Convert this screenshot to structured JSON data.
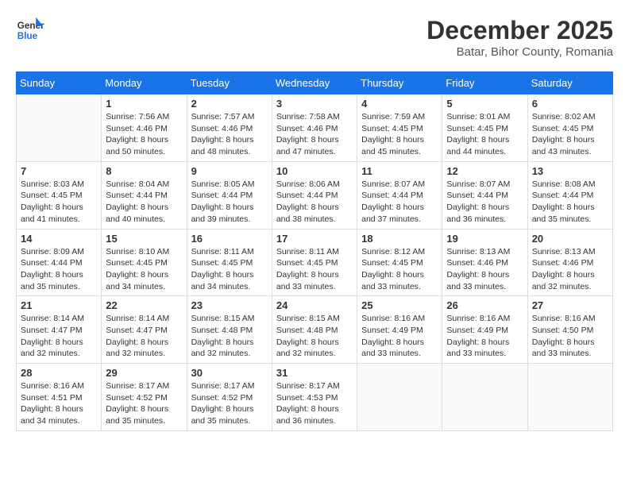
{
  "header": {
    "logo_general": "General",
    "logo_blue": "Blue",
    "month_title": "December 2025",
    "subtitle": "Batar, Bihor County, Romania"
  },
  "calendar": {
    "days_of_week": [
      "Sunday",
      "Monday",
      "Tuesday",
      "Wednesday",
      "Thursday",
      "Friday",
      "Saturday"
    ],
    "weeks": [
      [
        {
          "day": "",
          "info": ""
        },
        {
          "day": "1",
          "info": "Sunrise: 7:56 AM\nSunset: 4:46 PM\nDaylight: 8 hours\nand 50 minutes."
        },
        {
          "day": "2",
          "info": "Sunrise: 7:57 AM\nSunset: 4:46 PM\nDaylight: 8 hours\nand 48 minutes."
        },
        {
          "day": "3",
          "info": "Sunrise: 7:58 AM\nSunset: 4:46 PM\nDaylight: 8 hours\nand 47 minutes."
        },
        {
          "day": "4",
          "info": "Sunrise: 7:59 AM\nSunset: 4:45 PM\nDaylight: 8 hours\nand 45 minutes."
        },
        {
          "day": "5",
          "info": "Sunrise: 8:01 AM\nSunset: 4:45 PM\nDaylight: 8 hours\nand 44 minutes."
        },
        {
          "day": "6",
          "info": "Sunrise: 8:02 AM\nSunset: 4:45 PM\nDaylight: 8 hours\nand 43 minutes."
        }
      ],
      [
        {
          "day": "7",
          "info": "Sunrise: 8:03 AM\nSunset: 4:45 PM\nDaylight: 8 hours\nand 41 minutes."
        },
        {
          "day": "8",
          "info": "Sunrise: 8:04 AM\nSunset: 4:44 PM\nDaylight: 8 hours\nand 40 minutes."
        },
        {
          "day": "9",
          "info": "Sunrise: 8:05 AM\nSunset: 4:44 PM\nDaylight: 8 hours\nand 39 minutes."
        },
        {
          "day": "10",
          "info": "Sunrise: 8:06 AM\nSunset: 4:44 PM\nDaylight: 8 hours\nand 38 minutes."
        },
        {
          "day": "11",
          "info": "Sunrise: 8:07 AM\nSunset: 4:44 PM\nDaylight: 8 hours\nand 37 minutes."
        },
        {
          "day": "12",
          "info": "Sunrise: 8:07 AM\nSunset: 4:44 PM\nDaylight: 8 hours\nand 36 minutes."
        },
        {
          "day": "13",
          "info": "Sunrise: 8:08 AM\nSunset: 4:44 PM\nDaylight: 8 hours\nand 35 minutes."
        }
      ],
      [
        {
          "day": "14",
          "info": "Sunrise: 8:09 AM\nSunset: 4:44 PM\nDaylight: 8 hours\nand 35 minutes."
        },
        {
          "day": "15",
          "info": "Sunrise: 8:10 AM\nSunset: 4:45 PM\nDaylight: 8 hours\nand 34 minutes."
        },
        {
          "day": "16",
          "info": "Sunrise: 8:11 AM\nSunset: 4:45 PM\nDaylight: 8 hours\nand 34 minutes."
        },
        {
          "day": "17",
          "info": "Sunrise: 8:11 AM\nSunset: 4:45 PM\nDaylight: 8 hours\nand 33 minutes."
        },
        {
          "day": "18",
          "info": "Sunrise: 8:12 AM\nSunset: 4:45 PM\nDaylight: 8 hours\nand 33 minutes."
        },
        {
          "day": "19",
          "info": "Sunrise: 8:13 AM\nSunset: 4:46 PM\nDaylight: 8 hours\nand 33 minutes."
        },
        {
          "day": "20",
          "info": "Sunrise: 8:13 AM\nSunset: 4:46 PM\nDaylight: 8 hours\nand 32 minutes."
        }
      ],
      [
        {
          "day": "21",
          "info": "Sunrise: 8:14 AM\nSunset: 4:47 PM\nDaylight: 8 hours\nand 32 minutes."
        },
        {
          "day": "22",
          "info": "Sunrise: 8:14 AM\nSunset: 4:47 PM\nDaylight: 8 hours\nand 32 minutes."
        },
        {
          "day": "23",
          "info": "Sunrise: 8:15 AM\nSunset: 4:48 PM\nDaylight: 8 hours\nand 32 minutes."
        },
        {
          "day": "24",
          "info": "Sunrise: 8:15 AM\nSunset: 4:48 PM\nDaylight: 8 hours\nand 32 minutes."
        },
        {
          "day": "25",
          "info": "Sunrise: 8:16 AM\nSunset: 4:49 PM\nDaylight: 8 hours\nand 33 minutes."
        },
        {
          "day": "26",
          "info": "Sunrise: 8:16 AM\nSunset: 4:49 PM\nDaylight: 8 hours\nand 33 minutes."
        },
        {
          "day": "27",
          "info": "Sunrise: 8:16 AM\nSunset: 4:50 PM\nDaylight: 8 hours\nand 33 minutes."
        }
      ],
      [
        {
          "day": "28",
          "info": "Sunrise: 8:16 AM\nSunset: 4:51 PM\nDaylight: 8 hours\nand 34 minutes."
        },
        {
          "day": "29",
          "info": "Sunrise: 8:17 AM\nSunset: 4:52 PM\nDaylight: 8 hours\nand 35 minutes."
        },
        {
          "day": "30",
          "info": "Sunrise: 8:17 AM\nSunset: 4:52 PM\nDaylight: 8 hours\nand 35 minutes."
        },
        {
          "day": "31",
          "info": "Sunrise: 8:17 AM\nSunset: 4:53 PM\nDaylight: 8 hours\nand 36 minutes."
        },
        {
          "day": "",
          "info": ""
        },
        {
          "day": "",
          "info": ""
        },
        {
          "day": "",
          "info": ""
        }
      ]
    ]
  }
}
